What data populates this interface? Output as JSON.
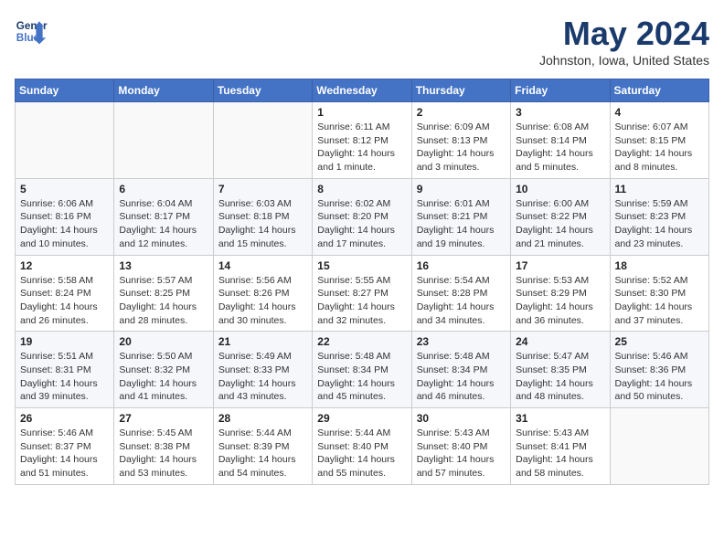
{
  "logo": {
    "line1": "General",
    "line2": "Blue"
  },
  "title": "May 2024",
  "location": "Johnston, Iowa, United States",
  "weekdays": [
    "Sunday",
    "Monday",
    "Tuesday",
    "Wednesday",
    "Thursday",
    "Friday",
    "Saturday"
  ],
  "weeks": [
    [
      {
        "day": "",
        "sunrise": "",
        "sunset": "",
        "daylight": ""
      },
      {
        "day": "",
        "sunrise": "",
        "sunset": "",
        "daylight": ""
      },
      {
        "day": "",
        "sunrise": "",
        "sunset": "",
        "daylight": ""
      },
      {
        "day": "1",
        "sunrise": "Sunrise: 6:11 AM",
        "sunset": "Sunset: 8:12 PM",
        "daylight": "Daylight: 14 hours and 1 minute."
      },
      {
        "day": "2",
        "sunrise": "Sunrise: 6:09 AM",
        "sunset": "Sunset: 8:13 PM",
        "daylight": "Daylight: 14 hours and 3 minutes."
      },
      {
        "day": "3",
        "sunrise": "Sunrise: 6:08 AM",
        "sunset": "Sunset: 8:14 PM",
        "daylight": "Daylight: 14 hours and 5 minutes."
      },
      {
        "day": "4",
        "sunrise": "Sunrise: 6:07 AM",
        "sunset": "Sunset: 8:15 PM",
        "daylight": "Daylight: 14 hours and 8 minutes."
      }
    ],
    [
      {
        "day": "5",
        "sunrise": "Sunrise: 6:06 AM",
        "sunset": "Sunset: 8:16 PM",
        "daylight": "Daylight: 14 hours and 10 minutes."
      },
      {
        "day": "6",
        "sunrise": "Sunrise: 6:04 AM",
        "sunset": "Sunset: 8:17 PM",
        "daylight": "Daylight: 14 hours and 12 minutes."
      },
      {
        "day": "7",
        "sunrise": "Sunrise: 6:03 AM",
        "sunset": "Sunset: 8:18 PM",
        "daylight": "Daylight: 14 hours and 15 minutes."
      },
      {
        "day": "8",
        "sunrise": "Sunrise: 6:02 AM",
        "sunset": "Sunset: 8:20 PM",
        "daylight": "Daylight: 14 hours and 17 minutes."
      },
      {
        "day": "9",
        "sunrise": "Sunrise: 6:01 AM",
        "sunset": "Sunset: 8:21 PM",
        "daylight": "Daylight: 14 hours and 19 minutes."
      },
      {
        "day": "10",
        "sunrise": "Sunrise: 6:00 AM",
        "sunset": "Sunset: 8:22 PM",
        "daylight": "Daylight: 14 hours and 21 minutes."
      },
      {
        "day": "11",
        "sunrise": "Sunrise: 5:59 AM",
        "sunset": "Sunset: 8:23 PM",
        "daylight": "Daylight: 14 hours and 23 minutes."
      }
    ],
    [
      {
        "day": "12",
        "sunrise": "Sunrise: 5:58 AM",
        "sunset": "Sunset: 8:24 PM",
        "daylight": "Daylight: 14 hours and 26 minutes."
      },
      {
        "day": "13",
        "sunrise": "Sunrise: 5:57 AM",
        "sunset": "Sunset: 8:25 PM",
        "daylight": "Daylight: 14 hours and 28 minutes."
      },
      {
        "day": "14",
        "sunrise": "Sunrise: 5:56 AM",
        "sunset": "Sunset: 8:26 PM",
        "daylight": "Daylight: 14 hours and 30 minutes."
      },
      {
        "day": "15",
        "sunrise": "Sunrise: 5:55 AM",
        "sunset": "Sunset: 8:27 PM",
        "daylight": "Daylight: 14 hours and 32 minutes."
      },
      {
        "day": "16",
        "sunrise": "Sunrise: 5:54 AM",
        "sunset": "Sunset: 8:28 PM",
        "daylight": "Daylight: 14 hours and 34 minutes."
      },
      {
        "day": "17",
        "sunrise": "Sunrise: 5:53 AM",
        "sunset": "Sunset: 8:29 PM",
        "daylight": "Daylight: 14 hours and 36 minutes."
      },
      {
        "day": "18",
        "sunrise": "Sunrise: 5:52 AM",
        "sunset": "Sunset: 8:30 PM",
        "daylight": "Daylight: 14 hours and 37 minutes."
      }
    ],
    [
      {
        "day": "19",
        "sunrise": "Sunrise: 5:51 AM",
        "sunset": "Sunset: 8:31 PM",
        "daylight": "Daylight: 14 hours and 39 minutes."
      },
      {
        "day": "20",
        "sunrise": "Sunrise: 5:50 AM",
        "sunset": "Sunset: 8:32 PM",
        "daylight": "Daylight: 14 hours and 41 minutes."
      },
      {
        "day": "21",
        "sunrise": "Sunrise: 5:49 AM",
        "sunset": "Sunset: 8:33 PM",
        "daylight": "Daylight: 14 hours and 43 minutes."
      },
      {
        "day": "22",
        "sunrise": "Sunrise: 5:48 AM",
        "sunset": "Sunset: 8:34 PM",
        "daylight": "Daylight: 14 hours and 45 minutes."
      },
      {
        "day": "23",
        "sunrise": "Sunrise: 5:48 AM",
        "sunset": "Sunset: 8:34 PM",
        "daylight": "Daylight: 14 hours and 46 minutes."
      },
      {
        "day": "24",
        "sunrise": "Sunrise: 5:47 AM",
        "sunset": "Sunset: 8:35 PM",
        "daylight": "Daylight: 14 hours and 48 minutes."
      },
      {
        "day": "25",
        "sunrise": "Sunrise: 5:46 AM",
        "sunset": "Sunset: 8:36 PM",
        "daylight": "Daylight: 14 hours and 50 minutes."
      }
    ],
    [
      {
        "day": "26",
        "sunrise": "Sunrise: 5:46 AM",
        "sunset": "Sunset: 8:37 PM",
        "daylight": "Daylight: 14 hours and 51 minutes."
      },
      {
        "day": "27",
        "sunrise": "Sunrise: 5:45 AM",
        "sunset": "Sunset: 8:38 PM",
        "daylight": "Daylight: 14 hours and 53 minutes."
      },
      {
        "day": "28",
        "sunrise": "Sunrise: 5:44 AM",
        "sunset": "Sunset: 8:39 PM",
        "daylight": "Daylight: 14 hours and 54 minutes."
      },
      {
        "day": "29",
        "sunrise": "Sunrise: 5:44 AM",
        "sunset": "Sunset: 8:40 PM",
        "daylight": "Daylight: 14 hours and 55 minutes."
      },
      {
        "day": "30",
        "sunrise": "Sunrise: 5:43 AM",
        "sunset": "Sunset: 8:40 PM",
        "daylight": "Daylight: 14 hours and 57 minutes."
      },
      {
        "day": "31",
        "sunrise": "Sunrise: 5:43 AM",
        "sunset": "Sunset: 8:41 PM",
        "daylight": "Daylight: 14 hours and 58 minutes."
      },
      {
        "day": "",
        "sunrise": "",
        "sunset": "",
        "daylight": ""
      }
    ]
  ]
}
